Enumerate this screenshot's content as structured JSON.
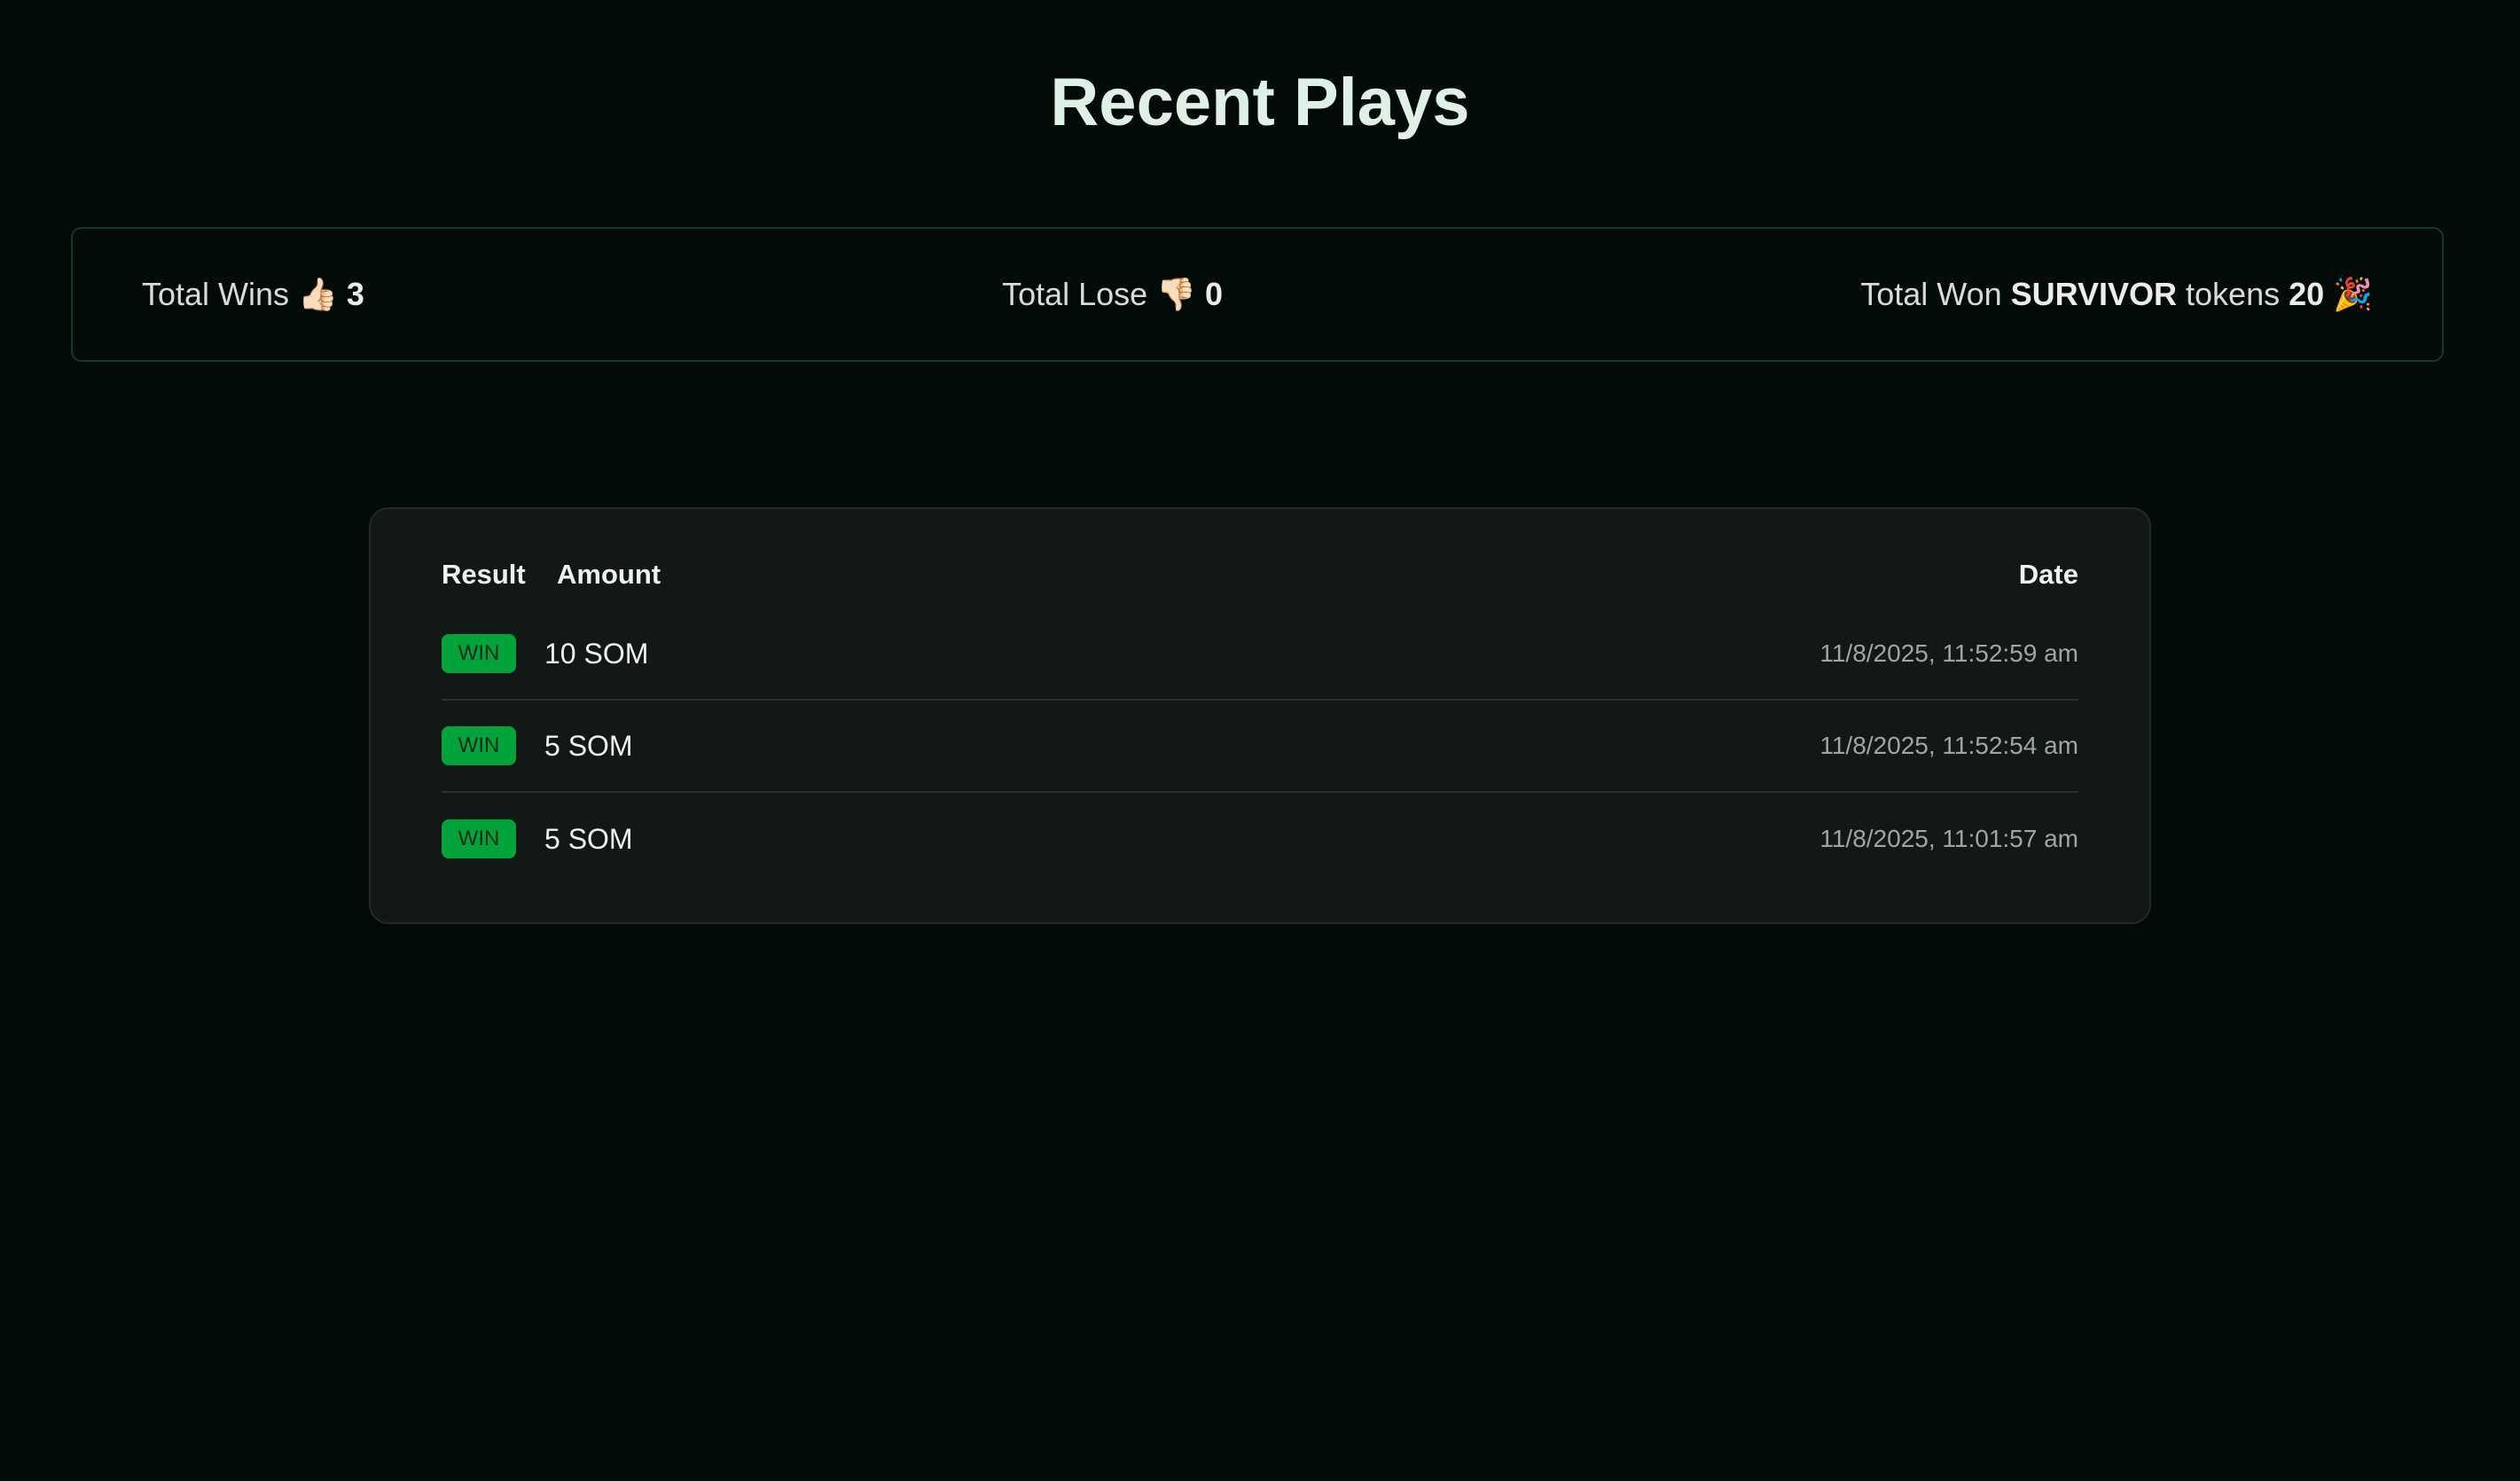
{
  "page": {
    "title": "Recent Plays"
  },
  "stats": {
    "wins_label": "Total Wins",
    "wins_emoji": "👍🏻",
    "wins_value": "3",
    "lose_label": "Total Lose",
    "lose_emoji": "👎🏻",
    "lose_value": "0",
    "won_prefix": "Total Won",
    "won_token": "SURVIVOR",
    "won_suffix": "tokens",
    "won_value": "20",
    "won_emoji": "🎉"
  },
  "table": {
    "headers": {
      "result": "Result",
      "amount": "Amount",
      "date": "Date"
    },
    "rows": [
      {
        "result": "WIN",
        "amount": "10 SOM",
        "date": "11/8/2025, 11:52:59 am"
      },
      {
        "result": "WIN",
        "amount": "5 SOM",
        "date": "11/8/2025, 11:52:54 am"
      },
      {
        "result": "WIN",
        "amount": "5 SOM",
        "date": "11/8/2025, 11:01:57 am"
      }
    ]
  },
  "colors": {
    "background": "#030b09",
    "win_badge": "#02a33a",
    "card": "#121816",
    "stats_border": "#163634"
  }
}
